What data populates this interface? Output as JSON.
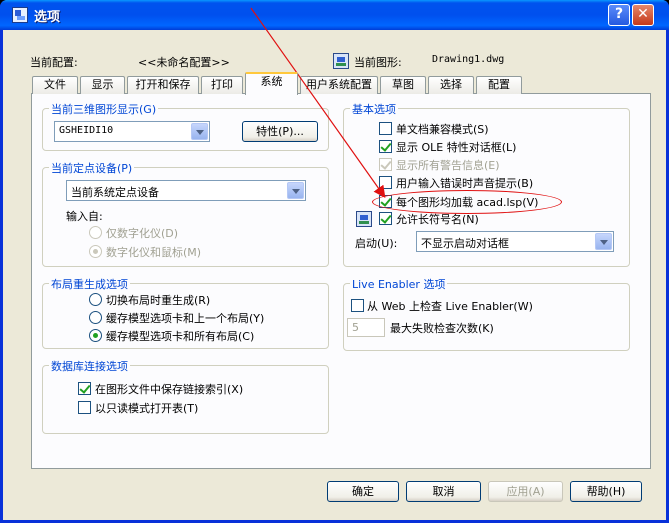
{
  "window": {
    "title": "选项"
  },
  "header": {
    "config_label": "当前配置:",
    "config_value": "<<未命名配置>>",
    "drawing_label": "当前图形:",
    "drawing_value": "Drawing1.dwg"
  },
  "tabs": [
    "文件",
    "显示",
    "打开和保存",
    "打印",
    "系统",
    "用户系统配置",
    "草图",
    "选择",
    "配置"
  ],
  "active_tab": "系统",
  "graphics3d": {
    "title": "当前三维图形显示(G)",
    "value": "GSHEIDI10",
    "properties_button": "特性(P)..."
  },
  "pointing": {
    "title": "当前定点设备(P)",
    "value": "当前系统定点设备",
    "accept_label": "输入自:",
    "options": [
      {
        "label": "仅数字化仪(D)",
        "checked": false,
        "disabled": true
      },
      {
        "label": "数字化仪和鼠标(M)",
        "checked": true,
        "disabled": true
      }
    ]
  },
  "layout_regen": {
    "title": "布局重生成选项",
    "options": [
      {
        "label": "切换布局时重生成(R)",
        "checked": false
      },
      {
        "label": "缓存模型选项卡和上一个布局(Y)",
        "checked": false
      },
      {
        "label": "缓存模型选项卡和所有布局(C)",
        "checked": true
      }
    ]
  },
  "dbconnect": {
    "title": "数据库连接选项",
    "options": [
      {
        "label": "在图形文件中保存链接索引(X)",
        "checked": true
      },
      {
        "label": "以只读模式打开表(T)",
        "checked": false
      }
    ]
  },
  "general": {
    "title": "基本选项",
    "options": [
      {
        "label": "单文档兼容模式(S)",
        "checked": false,
        "disabled": false
      },
      {
        "label": "显示 OLE 特性对话框(L)",
        "checked": true,
        "disabled": false
      },
      {
        "label": "显示所有警告信息(E)",
        "checked": true,
        "disabled": true
      },
      {
        "label": "用户输入错误时声音提示(B)",
        "checked": false,
        "disabled": false
      },
      {
        "label": "每个图形均加载 acad.lsp(V)",
        "checked": true,
        "disabled": false
      },
      {
        "label": "允许长符号名(N)",
        "checked": true,
        "disabled": false
      }
    ],
    "startup_label": "启动(U):",
    "startup_value": "不显示启动对话框"
  },
  "live_enabler": {
    "title": "Live Enabler 选项",
    "check_label": "从 Web 上检查 Live Enabler(W)",
    "check_checked": false,
    "max_value": "5",
    "max_label": "最大失败检查次数(K)"
  },
  "buttons": {
    "ok": "确定",
    "cancel": "取消",
    "apply": "应用(A)",
    "help": "帮助(H)"
  },
  "annotation_color": "#e01010"
}
